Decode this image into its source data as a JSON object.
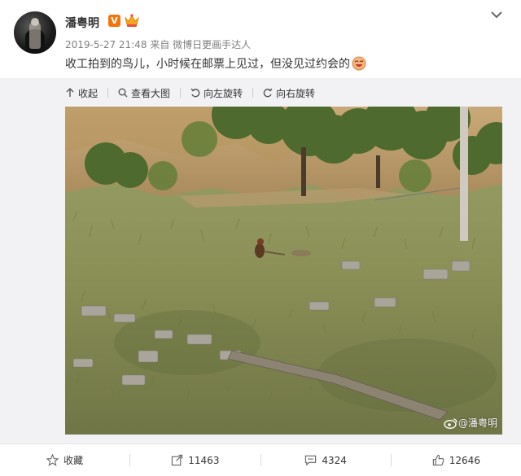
{
  "post": {
    "username": "潘粤明",
    "verified_badge": "V",
    "timestamp": "2019-5-27 21:48",
    "source_prefix": "来自",
    "source": "微博日更画手达人",
    "text": "收工拍到的鸟儿，小时候在邮票上见过，但没见过约会的",
    "icons": {
      "verified": "verified-badge-icon",
      "crown": "crown-icon",
      "menu": "chevron-down-icon",
      "emoji": "laugh-emoji-icon"
    }
  },
  "toolbar": {
    "collapse": "收起",
    "view_large": "查看大图",
    "rotate_left": "向左旋转",
    "rotate_right": "向右旋转"
  },
  "photo": {
    "watermark": "@潘粤明"
  },
  "footer": {
    "favorite": "收藏",
    "repost_count": "11463",
    "comment_count": "4324",
    "like_count": "12646"
  },
  "colors": {
    "accent_orange": "#f5740a",
    "meta_gray": "#808080",
    "media_bg": "#f2f2f5"
  }
}
